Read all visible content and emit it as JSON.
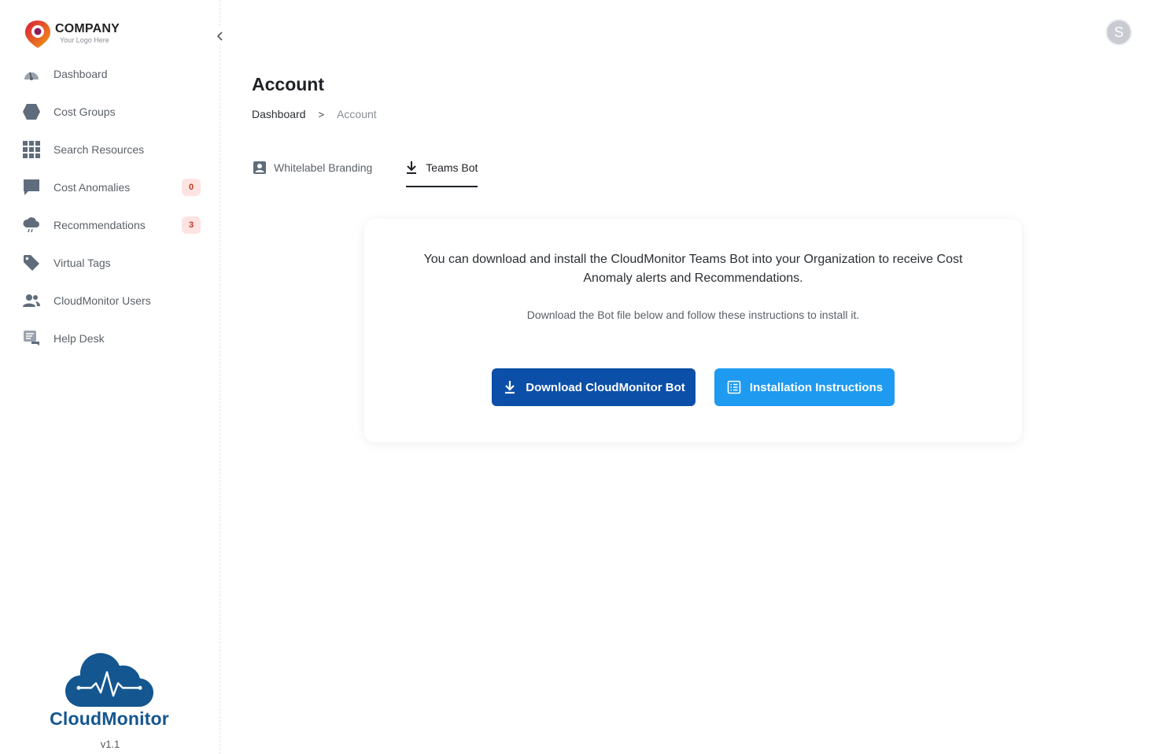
{
  "sidebar": {
    "logo": {
      "name": "COMPANY",
      "tagline": "Your Logo Here"
    },
    "collapse_icon": "chevron-left-icon",
    "items": [
      {
        "label": "Dashboard",
        "icon": "gauge-icon"
      },
      {
        "label": "Cost Groups",
        "icon": "hexagon-icon"
      },
      {
        "label": "Search Resources",
        "icon": "grid-icon"
      },
      {
        "label": "Cost Anomalies",
        "icon": "chat-bubble-icon",
        "badge": "0"
      },
      {
        "label": "Recommendations",
        "icon": "cloud-rain-icon",
        "badge": "3"
      },
      {
        "label": "Virtual Tags",
        "icon": "tag-icon"
      },
      {
        "label": "CloudMonitor Users",
        "icon": "users-icon"
      },
      {
        "label": "Help Desk",
        "icon": "help-desk-icon"
      }
    ],
    "brand": {
      "name": "CloudMonitor",
      "version": "v1.1"
    }
  },
  "header": {
    "avatar_initial": "S"
  },
  "page": {
    "title": "Account",
    "breadcrumb": {
      "parent": "Dashboard",
      "separator": ">",
      "current": "Account"
    }
  },
  "tabs": [
    {
      "label": "Whitelabel Branding",
      "icon": "id-badge-icon",
      "active": false
    },
    {
      "label": "Teams Bot",
      "icon": "download-icon",
      "active": true
    }
  ],
  "card": {
    "line1": "You can download and install the CloudMonitor Teams Bot into your Organization to receive Cost",
    "line2": "Anomaly alerts and Recommendations.",
    "subtext": "Download the Bot file below and follow these instructions to install it.",
    "primary_button": "Download CloudMonitor Bot",
    "secondary_button": "Installation Instructions"
  },
  "colors": {
    "primary_button": "#0b4fa8",
    "secondary_button": "#1e9af0",
    "brand": "#14568f",
    "badge_bg": "#fde3e1",
    "badge_text": "#c0392b"
  }
}
